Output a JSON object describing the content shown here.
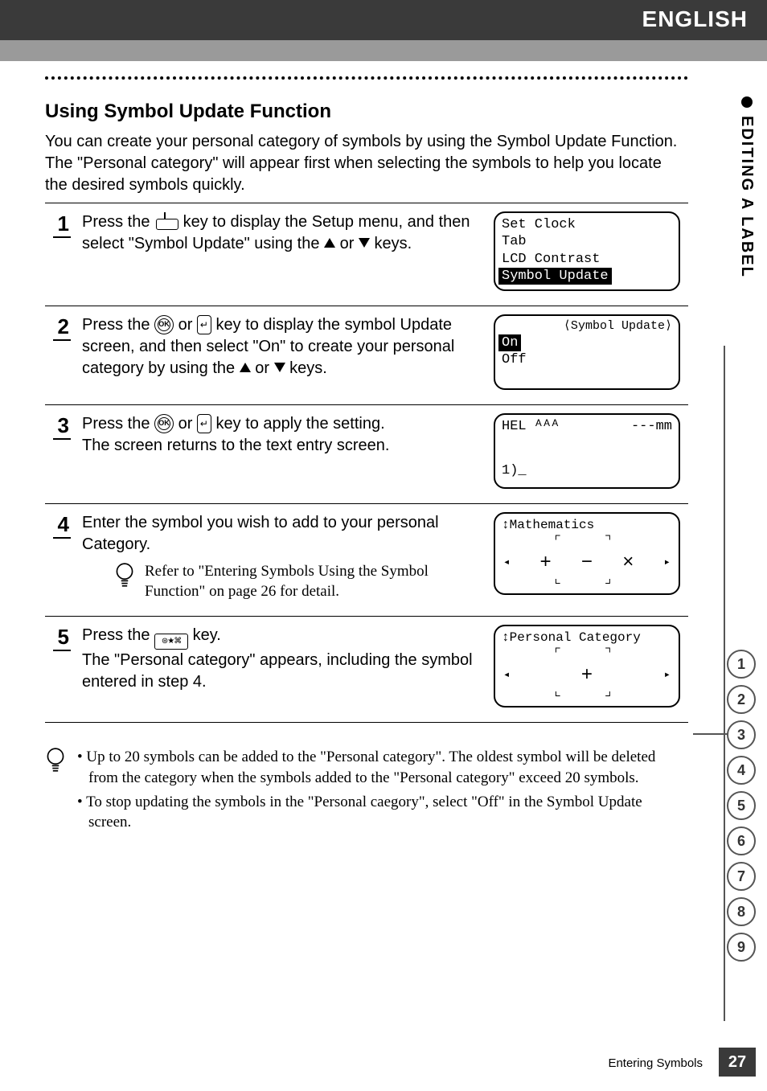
{
  "header": {
    "lang": "ENGLISH",
    "tab": "EDITING A LABEL"
  },
  "section": {
    "title": "Using Symbol Update Function",
    "intro": "You can create your personal category of symbols by using the Symbol Update Function. The \"Personal category\" will appear first when selecting the symbols to help you locate the desired symbols quickly."
  },
  "steps": [
    {
      "n": "1",
      "text_a": "Press the ",
      "text_b": " key to display the Setup menu, and then select \"Symbol Update\" using the ",
      "text_c": " or ",
      "text_d": " keys.",
      "lcd": {
        "l1": "Set Clock",
        "l2": "Tab",
        "l3": "LCD Contrast",
        "l4": "Symbol Update"
      }
    },
    {
      "n": "2",
      "text_a": "Press the ",
      "text_b": " or ",
      "text_c": " key to display the symbol Update screen, and then select \"On\" to create your personal category by using the ",
      "text_d": " or ",
      "text_e": " keys.",
      "lcd": {
        "title": "⟨Symbol Update⟩",
        "l1": "On",
        "l2": "Off"
      }
    },
    {
      "n": "3",
      "text_a": "Press the ",
      "text_b": " or ",
      "text_c": " key to apply the setting.",
      "text_d": "The screen returns to the text entry screen.",
      "lcd": {
        "top_left": "HEL ᴬᴬᴬ",
        "top_right": "---mm",
        "caret": "1)_"
      }
    },
    {
      "n": "4",
      "text_a": "Enter the symbol you wish to add to your personal Category.",
      "note": "Refer to \"Entering Symbols Using the Symbol Function\" on page 26 for detail.",
      "lcd": {
        "title": "Mathematics",
        "syms": [
          "+",
          "−",
          "×"
        ]
      }
    },
    {
      "n": "5",
      "text_a": "Press the ",
      "text_b": " key.",
      "text_c": "The \"Personal category\" appears, including the symbol entered in step 4.",
      "lcd": {
        "title": "Personal Category",
        "syms": [
          "+"
        ]
      }
    }
  ],
  "footnotes": [
    "Up to 20 symbols can be added to the \"Personal category\". The oldest symbol will be deleted from the category when the symbols added to the \"Personal category\" exceed 20 symbols.",
    "To stop updating the symbols in the \"Personal caegory\", select \"Off\" in the Symbol Update screen."
  ],
  "sidenav": {
    "items": [
      "1",
      "2",
      "3",
      "4",
      "5",
      "6",
      "7",
      "8",
      "9"
    ],
    "active": "3"
  },
  "footer": {
    "section": "Entering Symbols",
    "page": "27"
  }
}
